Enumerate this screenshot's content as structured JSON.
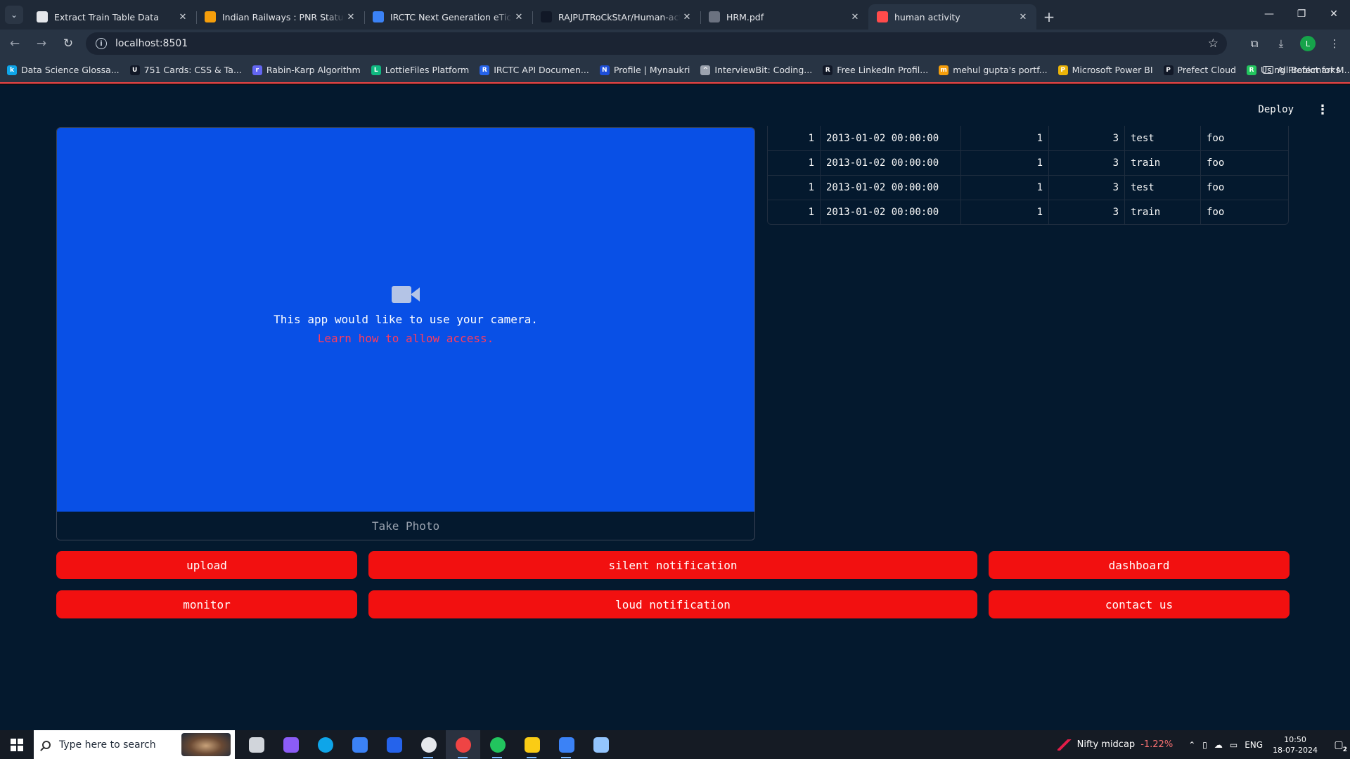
{
  "browser": {
    "tabs": [
      {
        "title": "Extract Train Table Data",
        "icon": "openai-icon",
        "icon_color": "#e5e7eb",
        "active": false
      },
      {
        "title": "Indian Railways : PNR Status",
        "icon": "railways-icon",
        "icon_color": "#f59e0b",
        "active": false
      },
      {
        "title": "IRCTC Next Generation eTicketing",
        "icon": "irctc-icon",
        "icon_color": "#3b82f6",
        "active": false
      },
      {
        "title": "RAJPUTRoCkStAr/Human-activity",
        "icon": "github-icon",
        "icon_color": "#111827",
        "active": false
      },
      {
        "title": "HRM.pdf",
        "icon": "globe-icon",
        "icon_color": "#6b7280",
        "active": false
      },
      {
        "title": "human activity",
        "icon": "streamlit-icon",
        "icon_color": "#ff4b4b",
        "active": true
      }
    ],
    "url": "localhost:8501",
    "profile_initial": "L",
    "bookmarks": [
      {
        "label": "Data Science Glossa...",
        "color": "#0ea5e9",
        "glyph": "k"
      },
      {
        "label": "751 Cards: CSS & Ta...",
        "color": "#111827",
        "glyph": "U"
      },
      {
        "label": "Rabin-Karp Algorithm",
        "color": "#6366f1",
        "glyph": "r"
      },
      {
        "label": "LottieFiles Platform",
        "color": "#10b981",
        "glyph": "L"
      },
      {
        "label": "IRCTC API Documen...",
        "color": "#2563eb",
        "glyph": "R"
      },
      {
        "label": "Profile | Mynaukri",
        "color": "#1d4ed8",
        "glyph": "N"
      },
      {
        "label": "InterviewBit: Coding...",
        "color": "#9ca3af",
        "glyph": "^"
      },
      {
        "label": "Free LinkedIn Profil...",
        "color": "#111827",
        "glyph": "R"
      },
      {
        "label": "mehul gupta's portf...",
        "color": "#f59e0b",
        "glyph": "m"
      },
      {
        "label": "Microsoft Power BI",
        "color": "#eab308",
        "glyph": "P"
      },
      {
        "label": "Prefect Cloud",
        "color": "#111827",
        "glyph": "P"
      },
      {
        "label": "Using Prefect for M...",
        "color": "#22c55e",
        "glyph": "R"
      }
    ],
    "bookmarks_more": "»",
    "all_bookmarks": "All Bookmarks"
  },
  "app": {
    "deploy_label": "Deploy",
    "camera": {
      "message": "This app would like to use your camera.",
      "link": "Learn how to allow access.",
      "take_photo": "Take Photo"
    },
    "table_rows": [
      [
        "1",
        "2013-01-02 00:00:00",
        "1",
        "3",
        "test",
        "foo"
      ],
      [
        "1",
        "2013-01-02 00:00:00",
        "1",
        "3",
        "train",
        "foo"
      ],
      [
        "1",
        "2013-01-02 00:00:00",
        "1",
        "3",
        "test",
        "foo"
      ],
      [
        "1",
        "2013-01-02 00:00:00",
        "1",
        "3",
        "train",
        "foo"
      ]
    ],
    "buttons": {
      "upload": "upload",
      "silent_notification": "silent notification",
      "dashboard": "dashboard",
      "monitor": "monitor",
      "loud_notification": "loud notification",
      "contact_us": "contact us"
    },
    "colors": {
      "button_bg": "#f21010",
      "camera_bg": "#0950e6",
      "app_bg": "#04192e",
      "link": "#ff3b5c"
    }
  },
  "taskbar": {
    "search_placeholder": "Type here to search",
    "ticker_name": "Nifty midcap",
    "ticker_change": "-1.22%",
    "language": "ENG",
    "time": "10:50",
    "date": "18-07-2024",
    "notification_count": "2",
    "apps": [
      {
        "name": "task-view-icon",
        "color": "#d1d5db"
      },
      {
        "name": "copilot-icon",
        "color": "#8b5cf6"
      },
      {
        "name": "edge-icon",
        "color": "#0ea5e9"
      },
      {
        "name": "store-icon",
        "color": "#3b82f6"
      },
      {
        "name": "mail-icon",
        "color": "#2563eb"
      },
      {
        "name": "github-desktop-icon",
        "color": "#e5e7eb"
      },
      {
        "name": "chrome-icon",
        "color": "#ef4444"
      },
      {
        "name": "spotify-icon",
        "color": "#22c55e"
      },
      {
        "name": "file-explorer-icon",
        "color": "#facc15"
      },
      {
        "name": "vscode-icon",
        "color": "#3b82f6"
      },
      {
        "name": "notepad-icon",
        "color": "#93c5fd"
      }
    ]
  }
}
